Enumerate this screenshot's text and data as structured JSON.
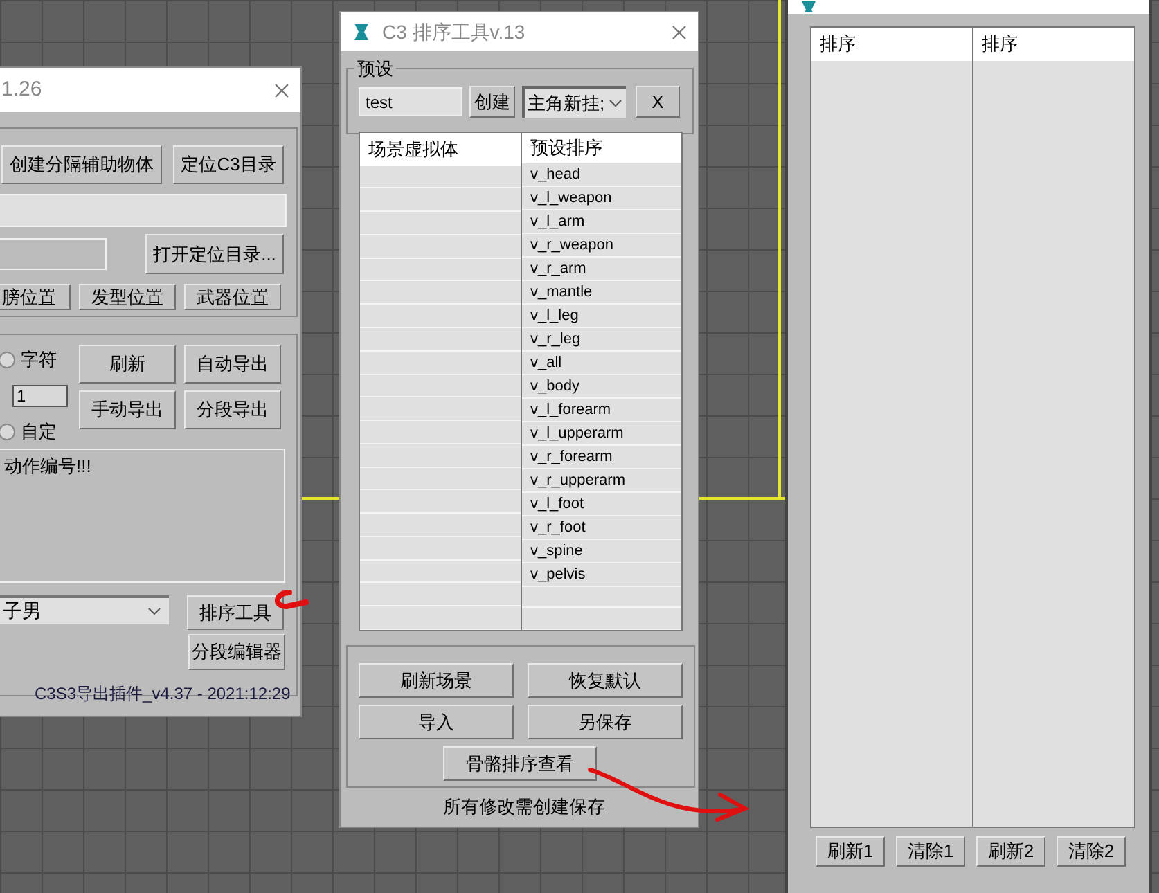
{
  "left_window": {
    "title": "1.26",
    "top_buttons": [
      "创建分隔辅助物体",
      "定位C3目录"
    ],
    "open_dir_button": "打开定位目录...",
    "position_buttons": [
      "膀位置",
      "发型位置",
      "武器位置"
    ],
    "radios": [
      {
        "label": "字符",
        "selected": false
      },
      {
        "label": "自定",
        "selected": false
      }
    ],
    "spinner_value": "1",
    "export_buttons": [
      "刷新",
      "自动导出",
      "手动导出",
      "分段导出"
    ],
    "log_text": "动作编号!!!",
    "dropdown_value": "子男",
    "sort_tool_button": "排序工具",
    "segment_editor_button": "分段编辑器",
    "footer": "C3S3导出插件_v4.37  - 2021:12:29"
  },
  "sort_window": {
    "title": "C3 排序工具v.13",
    "preset_group": "预设",
    "preset_name": "test",
    "create_button": "创建",
    "preset_dropdown": "主角新挂;",
    "delete_button": "X",
    "columns": [
      "场景虚拟体",
      "预设排序"
    ],
    "rows": [
      "v_head",
      "v_l_weapon",
      "v_l_arm",
      "v_r_weapon",
      "v_r_arm",
      "v_mantle",
      "v_l_leg",
      "v_r_leg",
      "v_all",
      "v_body",
      "v_l_forearm",
      "v_l_upperarm",
      "v_r_forearm",
      "v_r_upperarm",
      "v_l_foot",
      "v_r_foot",
      "v_spine",
      "v_pelvis"
    ],
    "buttons": [
      "刷新场景",
      "恢复默认",
      "导入",
      "另保存"
    ],
    "view_button": "骨骼排序查看",
    "footer": "所有修改需创建保存"
  },
  "viewer_window": {
    "columns": [
      "排序",
      "排序"
    ],
    "buttons": [
      "刷新1",
      "清除1",
      "刷新2",
      "清除2"
    ]
  }
}
